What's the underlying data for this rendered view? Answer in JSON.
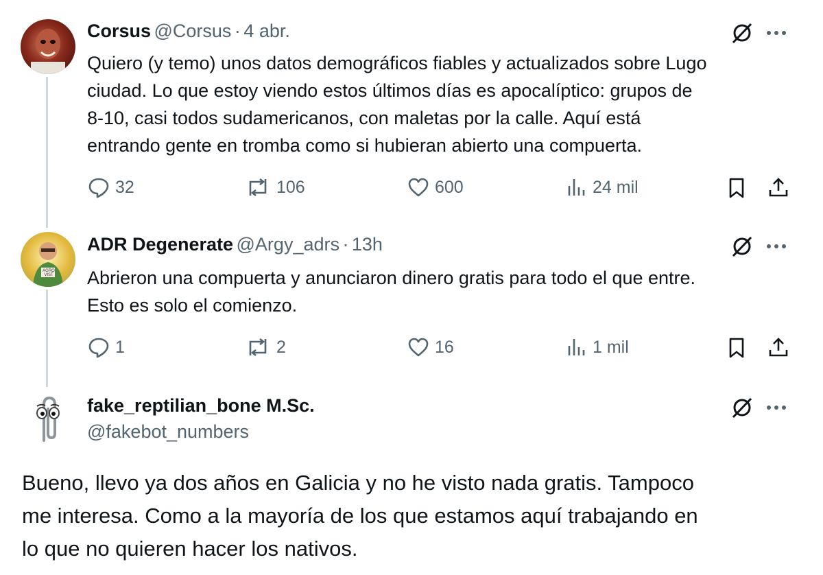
{
  "tweets": [
    {
      "name": "Corsus",
      "handle": "@Corsus",
      "sep": "·",
      "time": "4 abr.",
      "lines": [
        "Quiero (y temo) unos datos demográficos fiables y actualizados sobre Lugo",
        "ciudad. Lo que estoy viendo estos últimos días es apocalíptico: grupos de",
        "8-10, casi todos sudamericanos, con maletas por la calle. Aquí está",
        "entrando gente en tromba como si hubieran abierto una compuerta."
      ],
      "replies": "32",
      "reposts": "106",
      "likes": "600",
      "views": "24 mil",
      "avatar_color": "#7a1c14"
    },
    {
      "name": "ADR Degenerate",
      "handle": "@Argy_adrs",
      "sep": "·",
      "time": "13h",
      "lines": [
        "Abrieron una compuerta y anunciaron dinero gratis para todo el que entre.",
        "Esto es solo el comienzo."
      ],
      "replies": "1",
      "reposts": "2",
      "likes": "16",
      "views": "1 mil",
      "avatar_badge": "AGRO VIST",
      "avatar_color": "#e6c34a"
    },
    {
      "name": "fake_reptilian_bone M.Sc.",
      "handle": "@fakebot_numbers",
      "lines": [
        "Bueno, llevo ya dos años en Galicia y no he visto nada gratis. Tampoco",
        "me interesa. Como a la mayoría de los que estamos aquí trabajando en",
        "lo que no quieren hacer los nativos."
      ]
    }
  ],
  "icons": {
    "grok": "grok-icon",
    "more": "more-icon",
    "reply": "reply-icon",
    "repost": "repost-icon",
    "like": "like-icon",
    "views": "views-icon",
    "bookmark": "bookmark-icon",
    "share": "share-icon"
  },
  "colors": {
    "text": "#0f1419",
    "secondary": "#536471",
    "thread_line": "#cfd9de"
  }
}
